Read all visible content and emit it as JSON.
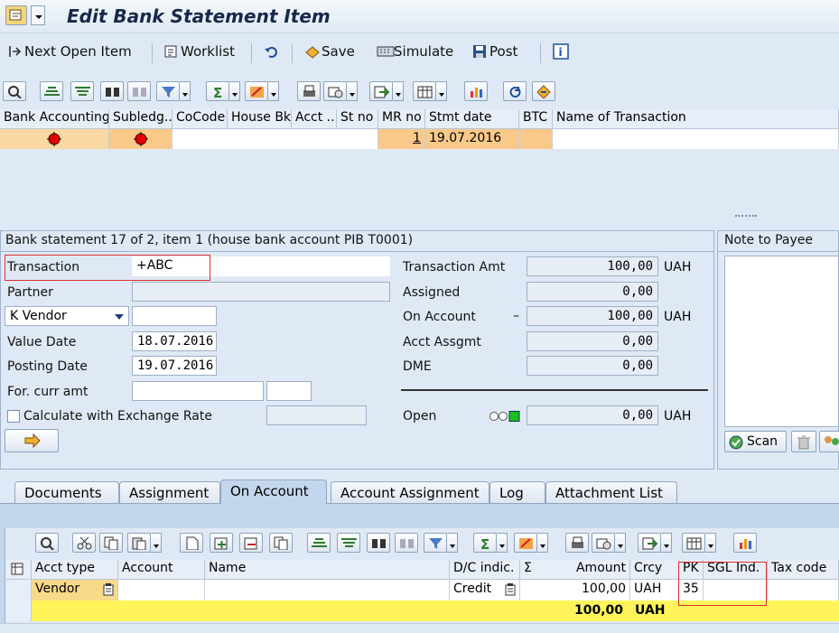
{
  "window": {
    "title": "Edit Bank Statement Item"
  },
  "app_toolbar": {
    "next_open_item": "Next Open Item",
    "worklist": "Worklist",
    "save": "Save",
    "simulate": "Simulate",
    "post": "Post"
  },
  "top_grid": {
    "columns": [
      "Bank Accounting",
      "Subledg...",
      "CoCode",
      "House Bk",
      "Acct ...",
      "St no",
      "MR no",
      "Stmt date",
      "BTC",
      "Name of Transaction"
    ],
    "row": {
      "mr_no": "1",
      "stmt_date": "19.07.2016"
    },
    "status_color": "#e00000",
    "highlight_color": "#f9c98a"
  },
  "statement_panel": {
    "header": "Bank statement 17 of 2, item 1 (house bank account PIB T0001)",
    "transaction_label": "Transaction",
    "transaction_value": "+ABC",
    "partner_label": "Partner",
    "partner_type": "K Vendor",
    "value_date_label": "Value Date",
    "value_date": "18.07.2016",
    "posting_date_label": "Posting Date",
    "posting_date": "19.07.2016",
    "for_curr_label": "For. curr amt",
    "calc_exchange_label": "Calculate with Exchange Rate",
    "transaction_amt_label": "Transaction Amt",
    "transaction_amt": "100,00",
    "assigned_label": "Assigned",
    "assigned": "0,00",
    "on_account_label": "On Account",
    "on_account_sign": "–",
    "on_account": "100,00",
    "acct_assgmt_label": "Acct Assgmt",
    "acct_assgmt": "0,00",
    "dme_label": "DME",
    "dme": "0,00",
    "open_label": "Open",
    "open": "0,00",
    "currency": "UAH"
  },
  "note_panel": {
    "header": "Note to Payee",
    "scan_label": "Scan"
  },
  "tabs": [
    {
      "label": "Documents"
    },
    {
      "label": "Assignment"
    },
    {
      "label": "On Account"
    },
    {
      "label": "Account Assignment"
    },
    {
      "label": "Log"
    },
    {
      "label": "Attachment List"
    }
  ],
  "bottom_grid": {
    "columns": {
      "acct_type": "Acct type",
      "account": "Account",
      "name": "Name",
      "dc": "D/C indic.",
      "sigma": "Σ",
      "amount": "Amount",
      "crcy": "Crcy",
      "pk": "PK",
      "sgl": "SGL Ind.",
      "tax": "Tax code"
    },
    "row": {
      "acct_type": "Vendor",
      "dc": "Credit",
      "amount": "100,00",
      "crcy": "UAH",
      "pk": "35"
    },
    "total": {
      "amount": "100,00",
      "crcy": "UAH"
    },
    "total_color": "#fff55a"
  }
}
